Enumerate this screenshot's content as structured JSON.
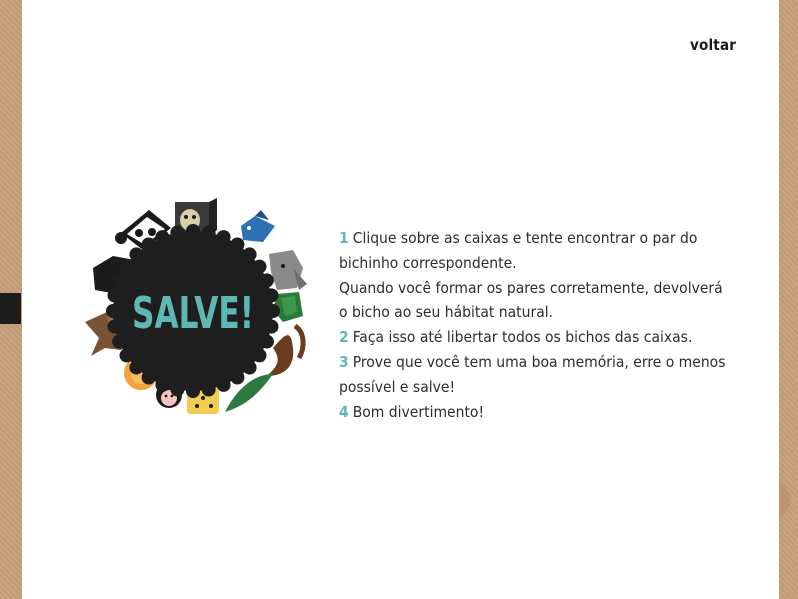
{
  "header": {
    "back_label": "voltar"
  },
  "logo": {
    "title": "SALVE!"
  },
  "instructions": {
    "lines": [
      {
        "num": "1",
        "text": "Clique sobre as caixas e tente encontrar o par do bichinho correspondente."
      },
      {
        "num": "",
        "text": "Quando você formar os pares corretamente, devolverá o bicho ao seu hábitat natural."
      },
      {
        "num": "2",
        "text": "Faça isso até libertar todos os bichos das caixas."
      },
      {
        "num": "3",
        "text": "Prove que você tem uma boa memória, erre o menos possível e salve!"
      },
      {
        "num": "4",
        "text": "Bom divertimento!"
      }
    ]
  },
  "colors": {
    "accent": "#5fb7b3",
    "badge": "#1e1e1e",
    "cardboard": "#c8a17a",
    "panel": "#ffffff"
  },
  "icons": [
    "panda-icon",
    "monkey-icon",
    "blue-fish-icon",
    "penguin-icon",
    "elephant-icon",
    "turtle-icon",
    "anteater-icon",
    "monkey-tail-icon",
    "lion-icon",
    "baby-monkey-icon",
    "jaguar-icon",
    "alligator-icon"
  ]
}
